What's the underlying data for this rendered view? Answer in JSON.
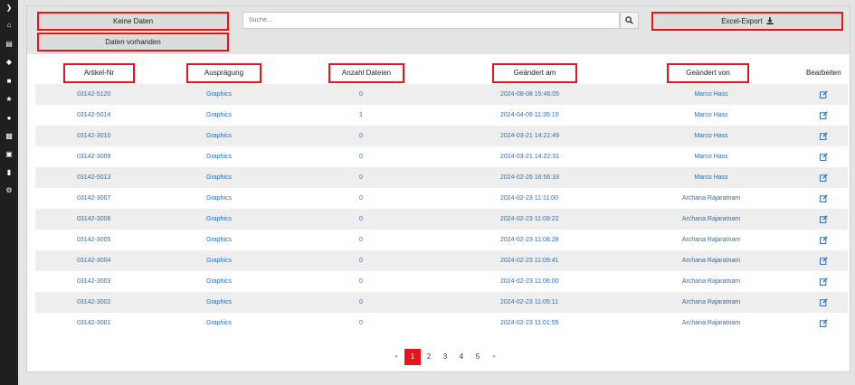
{
  "sidebar": {
    "icons": [
      "chevron-right-icon",
      "home-icon",
      "cart-icon",
      "tags-icon",
      "sitemap-icon",
      "star-icon",
      "chart-icon",
      "factory-icon",
      "clipboard-icon",
      "file-icon",
      "gear-icon"
    ]
  },
  "toolbar": {
    "keine_daten": "Keine Daten",
    "daten_vorhanden": "Daten vorhanden",
    "search_placeholder": "Suche...",
    "excel_export": "Excel-Export"
  },
  "columns": {
    "artikel": "Artikel-Nr",
    "auspraegung": "Ausprägung",
    "anzahl": "Anzahl Dateien",
    "geaendert_am": "Geändert am",
    "geaendert_von": "Geändert von",
    "bearbeiten": "Bearbeiten"
  },
  "rows": [
    {
      "artikel": "03142-5120",
      "auspraegung": "Graphics",
      "anzahl": "0",
      "geaendert_am": "2024-08-08 15:46:05",
      "geaendert_von": "Marco Hass"
    },
    {
      "artikel": "03142-5014",
      "auspraegung": "Graphics",
      "anzahl": "1",
      "geaendert_am": "2024-04-09 11:35:10",
      "geaendert_von": "Marco Hass"
    },
    {
      "artikel": "03142-3010",
      "auspraegung": "Graphics",
      "anzahl": "0",
      "geaendert_am": "2024-03-21 14:22:49",
      "geaendert_von": "Marco Hass"
    },
    {
      "artikel": "03142-3009",
      "auspraegung": "Graphics",
      "anzahl": "0",
      "geaendert_am": "2024-03-21 14:22:31",
      "geaendert_von": "Marco Hass"
    },
    {
      "artikel": "03142-5013",
      "auspraegung": "Graphics",
      "anzahl": "0",
      "geaendert_am": "2024-02-26 16:56:33",
      "geaendert_von": "Marco Hass"
    },
    {
      "artikel": "03142-3007",
      "auspraegung": "Graphics",
      "anzahl": "0",
      "geaendert_am": "2024-02-23 11:11:00",
      "geaendert_von": "Archana Rajaratnam"
    },
    {
      "artikel": "03142-3006",
      "auspraegung": "Graphics",
      "anzahl": "0",
      "geaendert_am": "2024-02-23 11:09:22",
      "geaendert_von": "Archana Rajaratnam"
    },
    {
      "artikel": "03142-3005",
      "auspraegung": "Graphics",
      "anzahl": "0",
      "geaendert_am": "2024-02-23 11:08:28",
      "geaendert_von": "Archana Rajaratnam"
    },
    {
      "artikel": "03142-3004",
      "auspraegung": "Graphics",
      "anzahl": "0",
      "geaendert_am": "2024-02-23 11:09:41",
      "geaendert_von": "Archana Rajaratnam"
    },
    {
      "artikel": "03142-3003",
      "auspraegung": "Graphics",
      "anzahl": "0",
      "geaendert_am": "2024-02-23 11:06:00",
      "geaendert_von": "Archana Rajaratnam"
    },
    {
      "artikel": "03142-3002",
      "auspraegung": "Graphics",
      "anzahl": "0",
      "geaendert_am": "2024-02-23 11:05:11",
      "geaendert_von": "Archana Rajaratnam"
    },
    {
      "artikel": "03142-3001",
      "auspraegung": "Graphics",
      "anzahl": "0",
      "geaendert_am": "2024-02-23 11:01:55",
      "geaendert_von": "Archana Rajaratnam"
    }
  ],
  "pagination": {
    "prev": "«",
    "pages": [
      "1",
      "2",
      "3",
      "4",
      "5"
    ],
    "next": "»",
    "current": "1"
  },
  "colors": {
    "accent": "#e8131c",
    "link": "#2a6eb7",
    "sidebar": "#1f1f1f"
  }
}
